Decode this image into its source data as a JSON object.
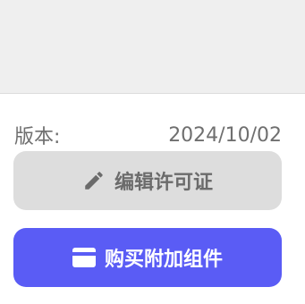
{
  "version": {
    "label": "版本:",
    "value": "2024/10/02"
  },
  "buttons": {
    "edit_license": {
      "label": "编辑许可证",
      "icon": "pencil-icon"
    },
    "buy_addons": {
      "label": "购买附加组件",
      "icon": "credit-card-icon"
    }
  },
  "colors": {
    "top_area_bg": "#efefef",
    "edit_button_bg": "#dddddd",
    "buy_button_bg": "#5a5cf5",
    "text_gray": "#6f6f6f"
  }
}
